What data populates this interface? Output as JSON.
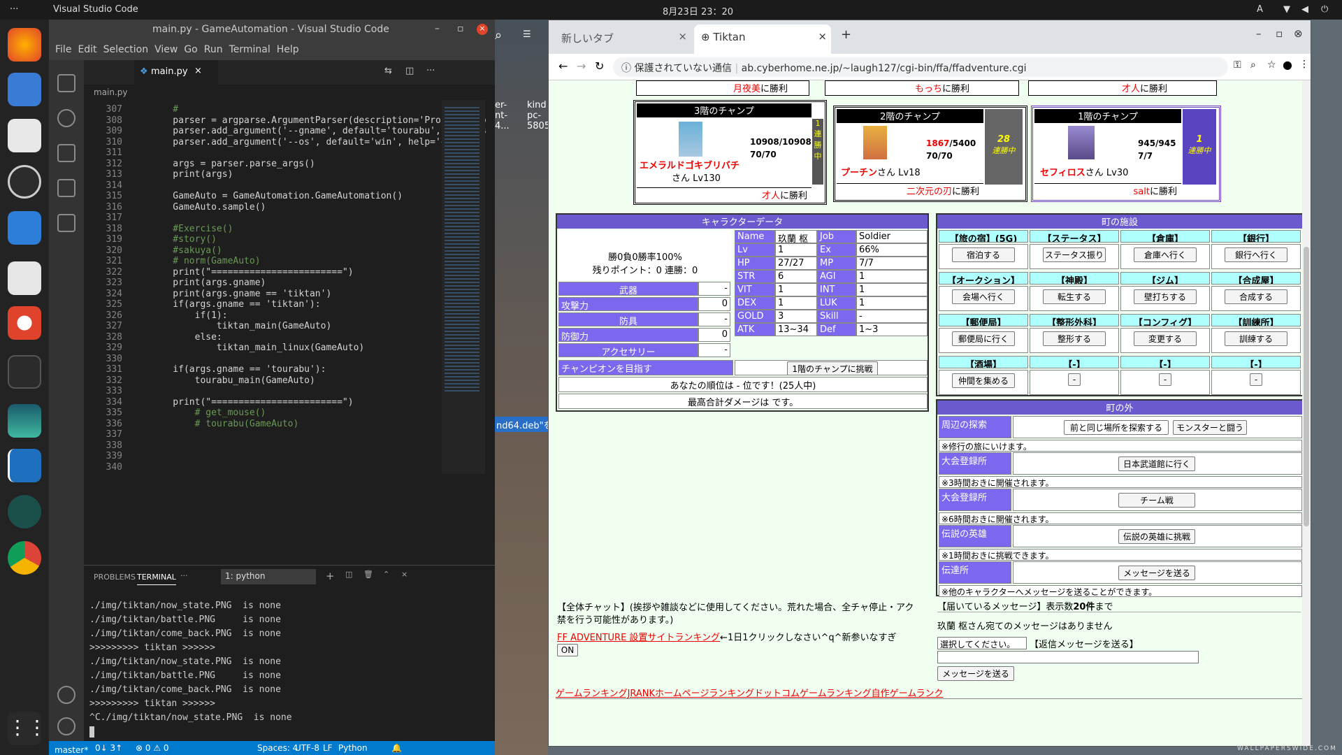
{
  "topbar": {
    "dots": "···",
    "app": "Visual Studio Code",
    "clock": "8月23日  23：20",
    "lang": "A"
  },
  "desktop": {
    "file1": "er-\nnt-\n4...",
    "file2": "kind\npc-\n5805",
    "deb": "nd64.deb\"を"
  },
  "vscode": {
    "title": "main.py - GameAutomation - Visual Studio Code",
    "menu": [
      "File",
      "Edit",
      "Selection",
      "View",
      "Go",
      "Run",
      "Terminal",
      "Help"
    ],
    "tab": "main.py",
    "crumb": "main.py",
    "lines": [
      {
        "n": "307",
        "t": "    #"
      },
      {
        "n": "308",
        "t": "    parser = argparse.ArgumentParser(description='Process some"
      },
      {
        "n": "309",
        "t": "    parser.add_argument('--gname', default='tourabu', help='gar"
      },
      {
        "n": "310",
        "t": "    parser.add_argument('--os', default='win', help='os info')"
      },
      {
        "n": "311",
        "t": ""
      },
      {
        "n": "312",
        "t": "    args = parser.parse_args()"
      },
      {
        "n": "313",
        "t": "    print(args)"
      },
      {
        "n": "314",
        "t": ""
      },
      {
        "n": "315",
        "t": "    GameAuto = GameAutomation.GameAutomation()"
      },
      {
        "n": "316",
        "t": "    GameAuto.sample()"
      },
      {
        "n": "317",
        "t": ""
      },
      {
        "n": "318",
        "t": "    #Exercise()"
      },
      {
        "n": "319",
        "t": "    #story()"
      },
      {
        "n": "320",
        "t": "    #sakuya()"
      },
      {
        "n": "321",
        "t": "    # norm(GameAuto)"
      },
      {
        "n": "322",
        "t": "    print(\"========================\")"
      },
      {
        "n": "323",
        "t": "    print(args.gname)"
      },
      {
        "n": "324",
        "t": "    print(args.gname == 'tiktan')"
      },
      {
        "n": "325",
        "t": "    if(args.gname == 'tiktan'):"
      },
      {
        "n": "326",
        "t": "        if(1):"
      },
      {
        "n": "327",
        "t": "            tiktan_main(GameAuto)"
      },
      {
        "n": "328",
        "t": "        else:"
      },
      {
        "n": "329",
        "t": "            tiktan_main_linux(GameAuto)"
      },
      {
        "n": "330",
        "t": ""
      },
      {
        "n": "331",
        "t": "    if(args.gname == 'tourabu'):"
      },
      {
        "n": "332",
        "t": "        tourabu_main(GameAuto)"
      },
      {
        "n": "333",
        "t": ""
      },
      {
        "n": "334",
        "t": "    print(\"========================\")"
      },
      {
        "n": "335",
        "t": "        # get_mouse()"
      },
      {
        "n": "336",
        "t": "        # tourabu(GameAuto)"
      },
      {
        "n": "337",
        "t": ""
      },
      {
        "n": "338",
        "t": ""
      },
      {
        "n": "339",
        "t": ""
      },
      {
        "n": "340",
        "t": ""
      }
    ],
    "panel_tabs": {
      "problems": "PROBLEMS",
      "terminal": "TERMINAL",
      "more": "···",
      "select": "1: python"
    },
    "terminal": [
      "./img/tiktan/now_state.PNG  is none",
      "./img/tiktan/battle.PNG     is none",
      "./img/tiktan/come_back.PNG  is none",
      ">>>>>>>>> tiktan >>>>>>",
      "./img/tiktan/now_state.PNG  is none",
      "./img/tiktan/battle.PNG     is none",
      "./img/tiktan/come_back.PNG  is none",
      ">>>>>>>>> tiktan >>>>>>",
      "^C./img/tiktan/now_state.PNG  is none"
    ],
    "status": {
      "branch": "master*",
      "sync": "0↓ 3↑",
      "problems": "⊗ 0 ⚠ 0",
      "spaces": "Spaces: 4",
      "enc": "UTF-8",
      "eol": "LF",
      "lang": "Python"
    }
  },
  "chrome": {
    "tab1": "新しいタブ",
    "tab2": "Tiktan",
    "security": "保護されていない通信",
    "url": "ab.cyberhome.ne.jp/~laugh127/cgi-bin/ffa/ffadventure.cgi"
  },
  "game": {
    "top_row": [
      {
        "name": "月夜美",
        "suffix": "に勝利"
      },
      {
        "name": "もっち",
        "suffix": "に勝利"
      },
      {
        "name": "才人",
        "suffix": "に勝利"
      }
    ],
    "champs": [
      {
        "title": "3階のチャンプ",
        "name": "エメラルドゴキブリバチ",
        "san": "さん Lv130",
        "hp": "10908/10908",
        "mp": "70/70",
        "streak": "1\n連\n勝\n中",
        "win_name": "才人",
        "win": "に勝利"
      },
      {
        "title": "2階のチャンプ",
        "name": "プーチン",
        "san": "さん Lv18",
        "hp_red": "1867",
        "hp_max": "/5400",
        "mp": "70/70",
        "streak_n": "28",
        "streak": "連勝中",
        "win_name": "二次元の刃",
        "win": "に勝利"
      },
      {
        "title": "1階のチャンプ",
        "name": "セフィロス",
        "san": "さん Lv30",
        "hp": "945/945",
        "mp": "7/7",
        "streak_n": "1",
        "streak": "連勝中",
        "win_name": "salt",
        "win": "に勝利"
      }
    ],
    "chardata": {
      "title": "キャラクターデータ",
      "record": "勝0負0勝率100%",
      "points": "残りポイント：0 連勝：0",
      "weapon": "武器",
      "atk_label": "攻撃力",
      "armor": "防具",
      "def_label": "防御力",
      "acc": "アクセサリー",
      "dash": "-",
      "zero": "0",
      "stats": [
        [
          "Name",
          "玖蘭 枢",
          "Job",
          "Soldier"
        ],
        [
          "Lv",
          "1",
          "Ex",
          "66%"
        ],
        [
          "HP",
          "27/27",
          "MP",
          "7/7"
        ],
        [
          "STR",
          "6",
          "AGI",
          "1"
        ],
        [
          "VIT",
          "1",
          "INT",
          "1"
        ],
        [
          "DEX",
          "1",
          "LUK",
          "1"
        ],
        [
          "GOLD",
          "3",
          "Skill",
          "-"
        ],
        [
          "ATK",
          "13~34",
          "Def",
          "1~3"
        ]
      ],
      "champ_goal": "チャンピオンを目指す",
      "challenge": "1階のチャンプに挑戦",
      "rank": "あなたの順位は - 位です！(25人中)",
      "maxdmg": "最高合計ダメージは です。"
    },
    "town": {
      "title": "町の施設",
      "items": [
        [
          "【旅の宿】(5G)",
          "宿泊する"
        ],
        [
          "【ステータス】",
          "ステータス振り"
        ],
        [
          "【倉庫】",
          "倉庫へ行く"
        ],
        [
          "【銀行】",
          "銀行へ行く"
        ],
        [
          "【オークション】",
          "会場へ行く"
        ],
        [
          "【神殿】",
          "転生する"
        ],
        [
          "【ジム】",
          "壁打ちする"
        ],
        [
          "【合成屋】",
          "合成する"
        ],
        [
          "【郵便局】",
          "郵便局に行く"
        ],
        [
          "【整形外科】",
          "整形する"
        ],
        [
          "【コンフィグ】",
          "変更する"
        ],
        [
          "【訓練所】",
          "訓練する"
        ],
        [
          "【酒場】",
          "仲間を集める"
        ],
        [
          "【-】",
          "-"
        ],
        [
          "【-】",
          "-"
        ],
        [
          "【-】",
          "-"
        ]
      ]
    },
    "outside": {
      "title": "町の外",
      "rows": [
        {
          "label": "周辺の探索",
          "select": "前と同じ場所を探索する",
          "btn": "モンスターと闘う",
          "note": "※修行の旅にいけます。"
        },
        {
          "label": "大会登録所",
          "btn": "日本武道館に行く",
          "note": "※3時間おきに開催されます。"
        },
        {
          "label": "大会登録所",
          "btn": "チーム戦",
          "note": "※6時間おきに開催されます。"
        },
        {
          "label": "伝説の英雄",
          "btn": "伝説の英雄に挑戦",
          "note": "※1時間おきに挑戦できます。"
        },
        {
          "label": "伝達所",
          "btn": "メッセージを送る",
          "note": "※他のキャラクターへメッセージを送ることができます。"
        }
      ]
    },
    "messages": {
      "head": "【届いているメッセージ】表示数",
      "count": "20件",
      "tail": "まで",
      "none": "玖蘭 枢さん宛てのメッセージはありません",
      "select": "選択してください。",
      "reply": "【返信メッセージを送る】",
      "send": "メッセージを送る"
    },
    "chat": {
      "text": "【全体チャット】(挨拶や雑談などに使用してください。荒れた場合、全チャ停止・アク禁を行う可能性があります。)",
      "rank_link": "FF ADVENTURE 設置サイトランキング",
      "rank_tail": "←1日1クリックしなさい^q^新参いなすぎ",
      "on": "ON"
    },
    "footer_links": "ゲームランキングJRANKホームページランキングドットコムゲームランキング自作ゲームランク"
  },
  "watermark": "WALLPAPERSWIDE.COM"
}
